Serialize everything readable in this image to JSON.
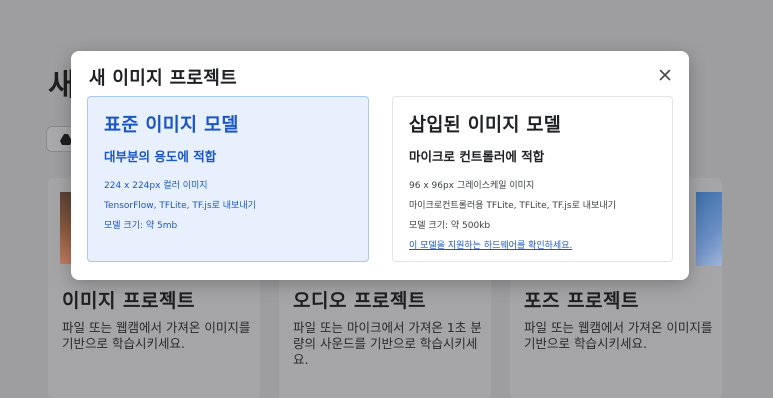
{
  "background": {
    "page_title": "새",
    "cards": [
      {
        "title": "이미지 프로젝트",
        "description": "파일 또는 웹캠에서 가져온 이미지를 기반으로 학습시키세요."
      },
      {
        "title": "오디오 프로젝트",
        "description": "파일 또는 마이크에서 가져온 1초 분량의 사운드를 기반으로 학습시키세요."
      },
      {
        "title": "포즈 프로젝트",
        "description": "파일 또는 웹캠에서 가져온 이미지를 기반으로 학습시키세요."
      }
    ]
  },
  "modal": {
    "title": "새 이미지 프로젝트",
    "close_icon": "close-icon",
    "options": {
      "standard": {
        "title": "표준 이미지 모델",
        "subtitle": "대부분의 용도에 적합",
        "lines": [
          "224 x 224px 컬러 이미지",
          "TensorFlow, TFLite, TF.js로 내보내기",
          "모델 크기: 약 5mb"
        ]
      },
      "embedded": {
        "title": "삽입된 이미지 모델",
        "subtitle": "마이크로 컨트롤러에 적합",
        "lines": [
          "96 x 96px 그레이스케일 이미지",
          "마이크로컨트롤러용 TFLite, TFLite, TF.js로 내보내기",
          "모델 크기: 약 500kb"
        ],
        "link": "이 모델을 지원하는 하드웨어를 확인하세요."
      }
    }
  },
  "colors": {
    "accent": "#1a56c4",
    "selected_bg": "#e8f0fe",
    "overlay": "#9e9ea0"
  }
}
